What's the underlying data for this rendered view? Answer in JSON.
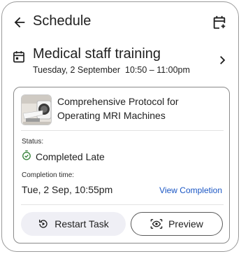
{
  "header": {
    "title": "Schedule",
    "back_icon": "arrow-back-icon",
    "add_icon": "calendar-add-icon"
  },
  "event": {
    "icon": "calendar-icon",
    "title": "Medical staff training",
    "date": "Tuesday, 2 September",
    "time": "10:50 – 11:00pm",
    "chevron_icon": "chevron-right-icon"
  },
  "task": {
    "course_title": "Comprehensive Protocol for Operating MRI Machines",
    "thumbnail": "mri-machine-image",
    "status_label": "Status:",
    "status_value": "Completed Late",
    "status_icon": "timer-check-icon",
    "completion_label": "Completion time:",
    "completion_value": "Tue, 2 Sep, 10:55pm",
    "view_link": "View Completion",
    "restart_label": "Restart Task",
    "preview_label": "Preview"
  },
  "colors": {
    "link": "#1a56c4",
    "status_icon": "#2e7d32",
    "restart_bg": "#efeff5",
    "border": "#8a8a8a"
  }
}
